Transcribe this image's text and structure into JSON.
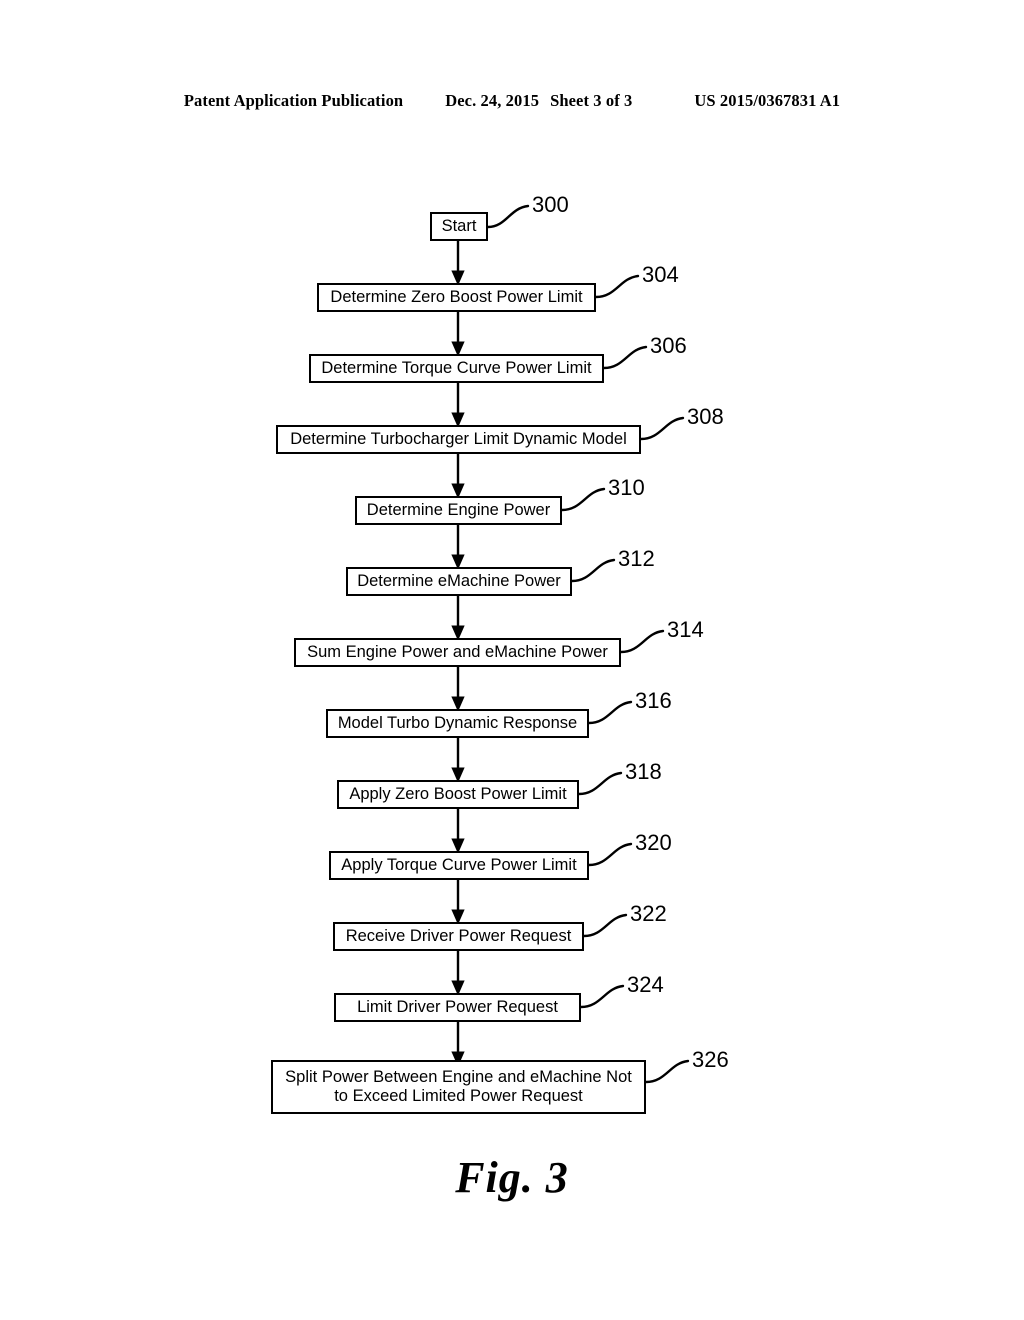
{
  "header": {
    "publication": "Patent Application Publication",
    "date": "Dec. 24, 2015",
    "sheet": "Sheet 3 of 3",
    "patent_number": "US 2015/0367831 A1"
  },
  "figure": {
    "caption": "Fig. 3"
  },
  "flowchart": {
    "nodes": [
      {
        "ref": "300",
        "label": "Start"
      },
      {
        "ref": "304",
        "label": "Determine Zero Boost Power Limit"
      },
      {
        "ref": "306",
        "label": "Determine Torque Curve Power Limit"
      },
      {
        "ref": "308",
        "label": "Determine Turbocharger Limit Dynamic Model"
      },
      {
        "ref": "310",
        "label": "Determine Engine Power"
      },
      {
        "ref": "312",
        "label": "Determine eMachine Power"
      },
      {
        "ref": "314",
        "label": "Sum Engine Power and eMachine Power"
      },
      {
        "ref": "316",
        "label": "Model Turbo Dynamic Response"
      },
      {
        "ref": "318",
        "label": "Apply Zero Boost Power Limit"
      },
      {
        "ref": "320",
        "label": "Apply Torque Curve Power Limit"
      },
      {
        "ref": "322",
        "label": "Receive Driver Power Request"
      },
      {
        "ref": "324",
        "label": "Limit Driver Power Request"
      },
      {
        "ref": "326",
        "label": "Split Power Between Engine and eMachine Not\nto Exceed Limited Power Request"
      }
    ]
  },
  "colors": {
    "ink": "#000000",
    "paper": "#ffffff"
  }
}
